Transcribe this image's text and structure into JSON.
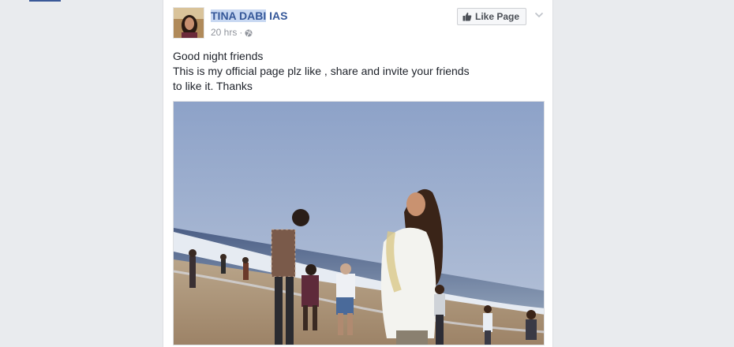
{
  "post": {
    "page_name_highlighted": "TINA DABI",
    "page_name_rest": " IAS",
    "timestamp": "20 hrs",
    "separator": "·",
    "like_button_label": "Like Page",
    "text_lines": [
      "Good night friends",
      "This is my official page plz like , share and invite your friends",
      "to like it. Thanks"
    ]
  },
  "icons": {
    "audience": "globe-icon",
    "like": "thumb-icon",
    "options": "chevron-down-icon"
  },
  "colors": {
    "background": "#e9ebee",
    "link_blue": "#365899",
    "brand_blue": "#3b5998",
    "meta_gray": "#90949c"
  }
}
